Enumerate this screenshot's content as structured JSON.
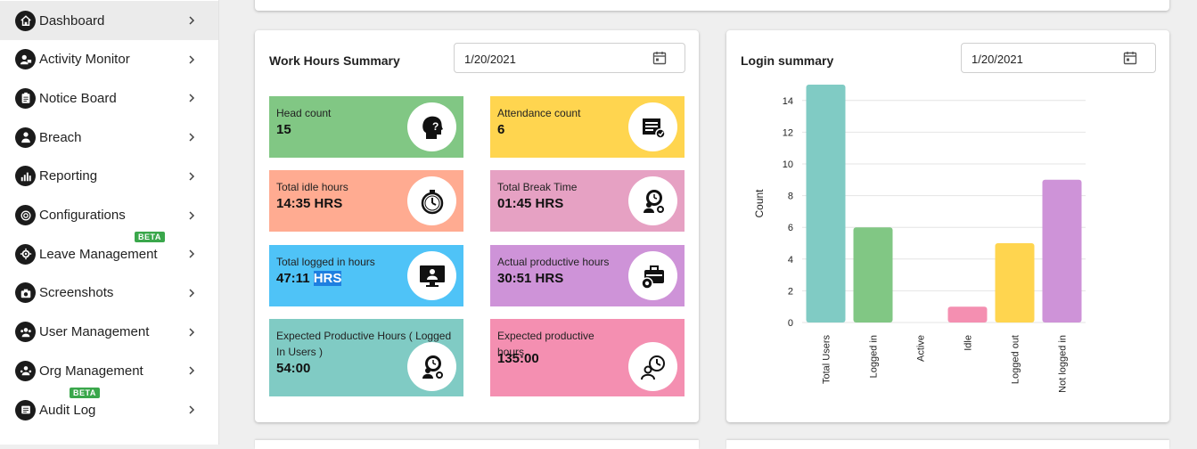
{
  "sidebar": {
    "items": [
      {
        "label": "Dashboard",
        "icon": "home-icon",
        "active": true
      },
      {
        "label": "Activity Monitor",
        "icon": "user-monitor-icon"
      },
      {
        "label": "Notice Board",
        "icon": "clipboard-icon"
      },
      {
        "label": "Breach",
        "icon": "breach-user-icon"
      },
      {
        "label": "Reporting",
        "icon": "bar-chart-icon"
      },
      {
        "label": "Configurations",
        "icon": "config-icon"
      },
      {
        "label": "Leave Management",
        "icon": "leave-icon",
        "badge": "BETA"
      },
      {
        "label": "Screenshots",
        "icon": "camera-icon"
      },
      {
        "label": "User Management",
        "icon": "users-icon"
      },
      {
        "label": "Org Management",
        "icon": "org-icon"
      },
      {
        "label": "Audit Log",
        "icon": "log-icon",
        "badge": "BETA"
      }
    ]
  },
  "work_hours": {
    "title": "Work Hours Summary",
    "date": "1/20/2021",
    "tiles": [
      {
        "label": "Head count",
        "value": "15",
        "color": "#81c784",
        "icon": "head-question-icon"
      },
      {
        "label": "Attendance count",
        "value": "6",
        "color": "#ffd54f",
        "icon": "attendance-icon"
      },
      {
        "label": "Total idle hours",
        "value": "14:35 HRS",
        "color": "#ffab91",
        "icon": "stopwatch-icon"
      },
      {
        "label": "Total Break Time",
        "value": "01:45 HRS",
        "color": "#e6a1c3",
        "icon": "break-time-icon"
      },
      {
        "label": "Total logged in hours",
        "value_main": "47:11",
        "value_hl": "HRS",
        "color": "#4fc3f7",
        "icon": "monitor-user-icon"
      },
      {
        "label": "Actual productive hours",
        "value": "30:51 HRS",
        "color": "#ce93d8",
        "icon": "briefcase-gear-icon"
      },
      {
        "label": "Expected Productive Hours ( Logged In Users )",
        "value": "54:00",
        "color": "#80cbc4",
        "icon": "clock-gear-icon"
      },
      {
        "label": "Expected productive hours",
        "value": "135:00",
        "color": "#f48fb1",
        "icon": "user-clock-icon"
      }
    ]
  },
  "login_summary": {
    "title": "Login summary",
    "date": "1/20/2021"
  },
  "chart_data": {
    "type": "bar",
    "categories": [
      "Total Users",
      "Logged in",
      "Active",
      "Idle",
      "Logged out",
      "Not logged in"
    ],
    "values": [
      15,
      6,
      0,
      1,
      5,
      9
    ],
    "colors": [
      "#80cbc4",
      "#81c784",
      "#4fc3f7",
      "#f48fb1",
      "#ffd54f",
      "#ce93d8"
    ],
    "ylabel": "Count",
    "ylim": [
      0,
      15
    ],
    "yticks": [
      0,
      2,
      4,
      6,
      8,
      10,
      12,
      14
    ],
    "grid": true
  }
}
